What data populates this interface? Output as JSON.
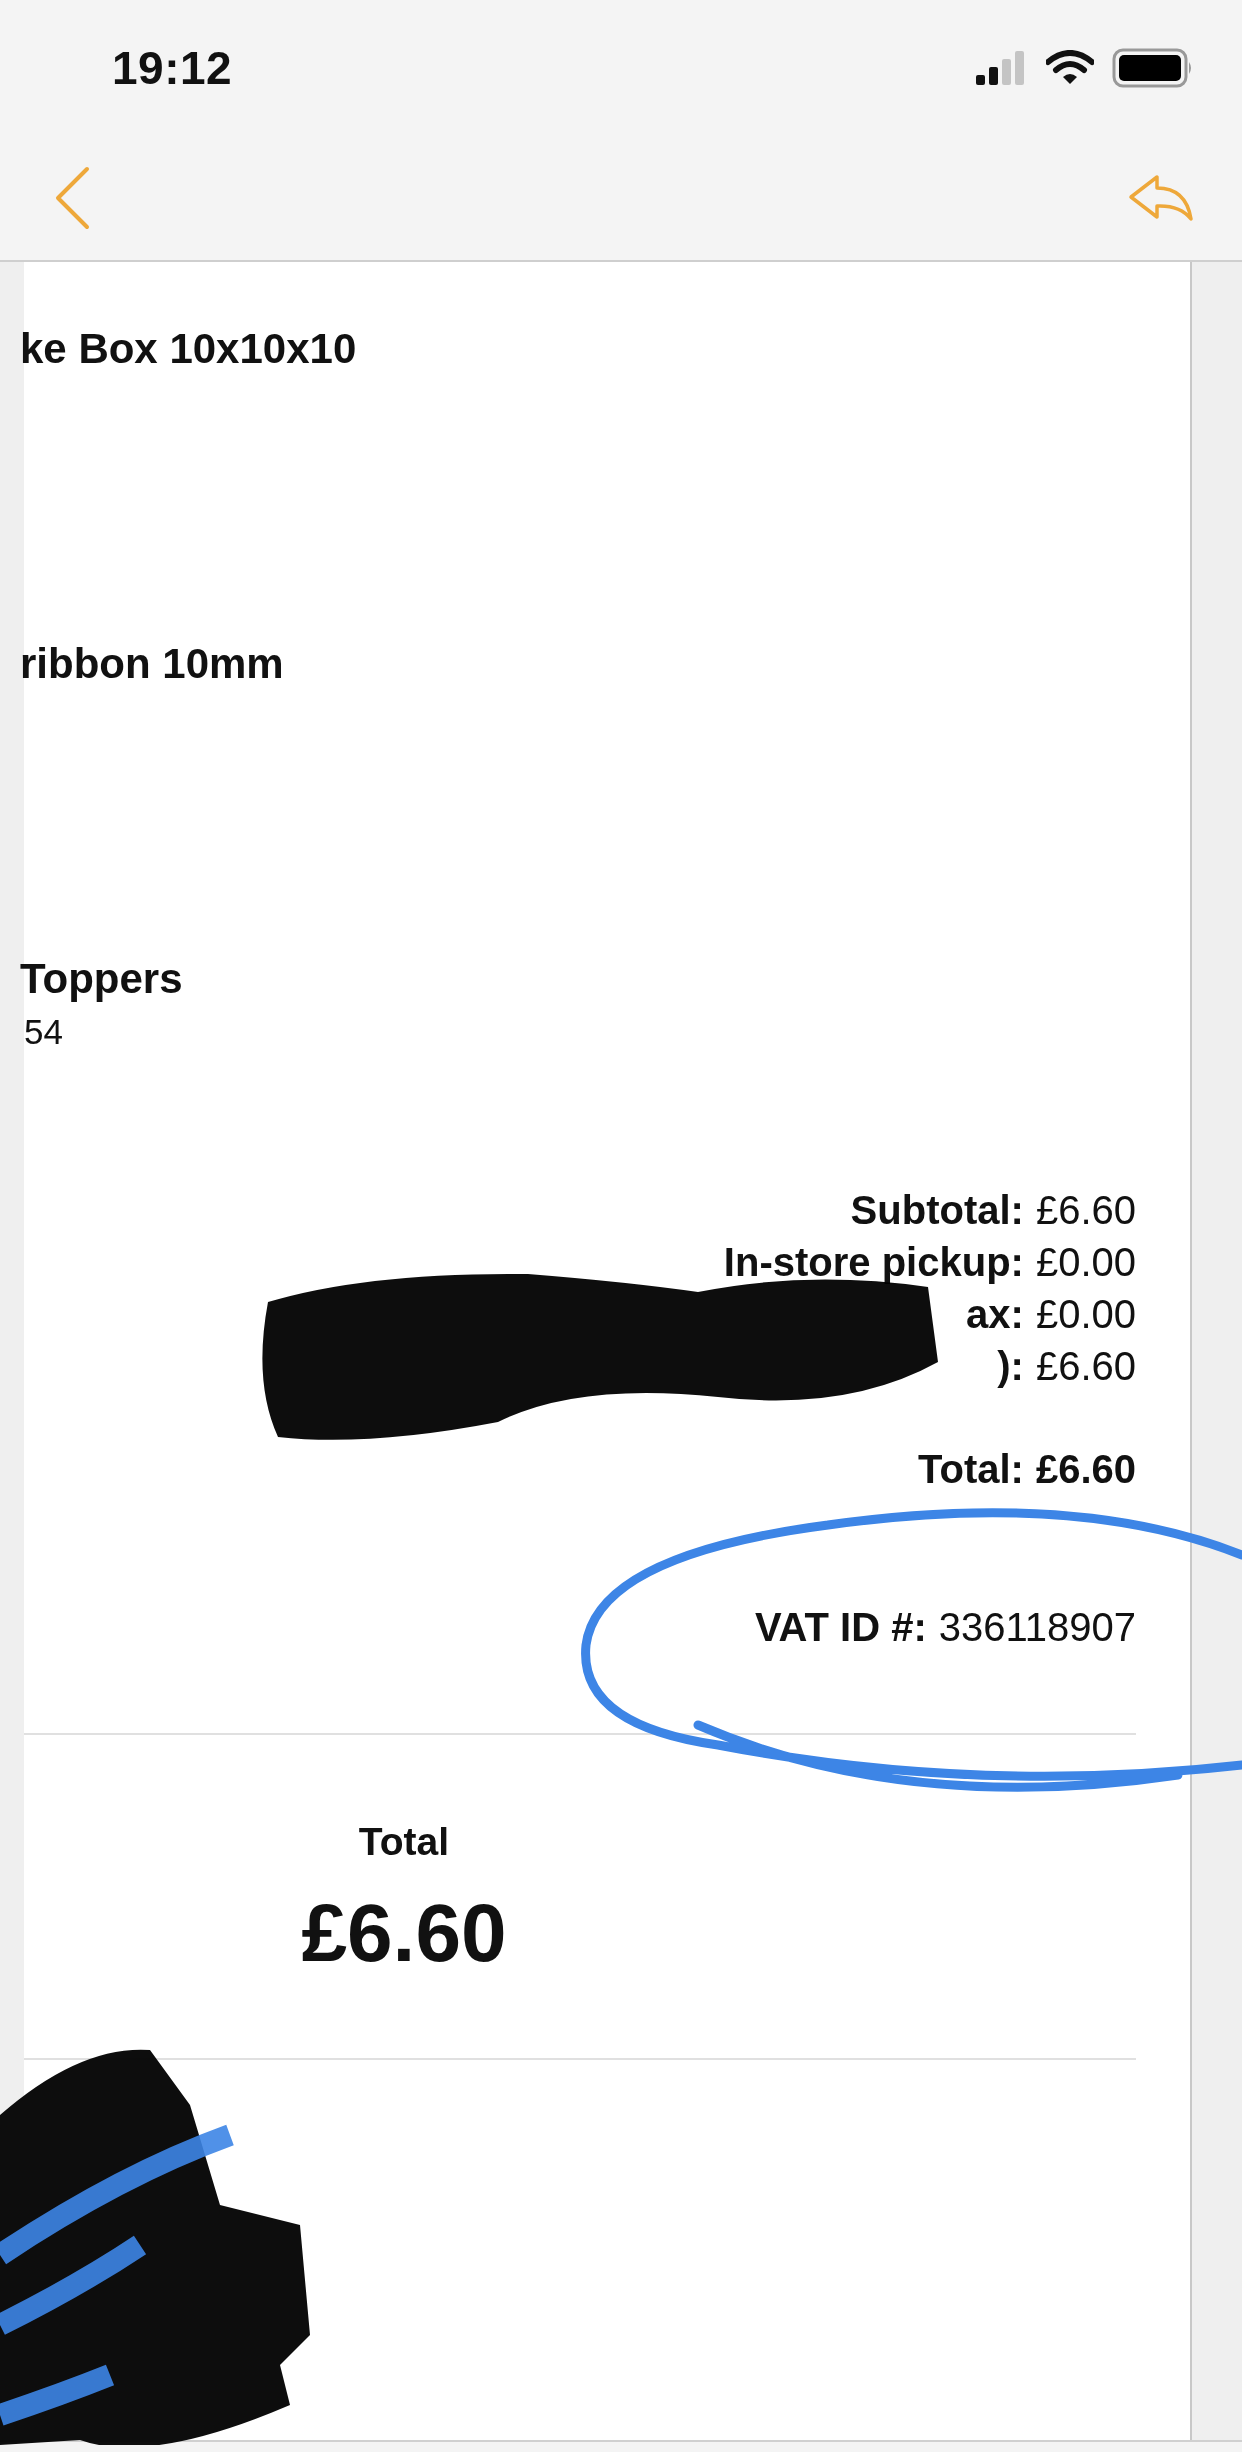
{
  "status_bar": {
    "time": "19:12"
  },
  "items": [
    {
      "name": "ke Box 10x10x10"
    },
    {
      "name": "ribbon 10mm"
    },
    {
      "name": "Toppers",
      "detail": "54"
    }
  ],
  "summary": [
    {
      "label": "Subtotal:",
      "value": "£6.60"
    },
    {
      "label": "In-store pickup:",
      "value": "£0.00"
    },
    {
      "label": "ax:",
      "value": "£0.00"
    },
    {
      "label": "):",
      "value": "£6.60"
    }
  ],
  "total": {
    "label": "Total:",
    "value": "£6.60"
  },
  "vat": {
    "label": "VAT ID #:",
    "value": "336118907"
  },
  "grand_total": {
    "label": "Total",
    "amount": "£6.60"
  }
}
